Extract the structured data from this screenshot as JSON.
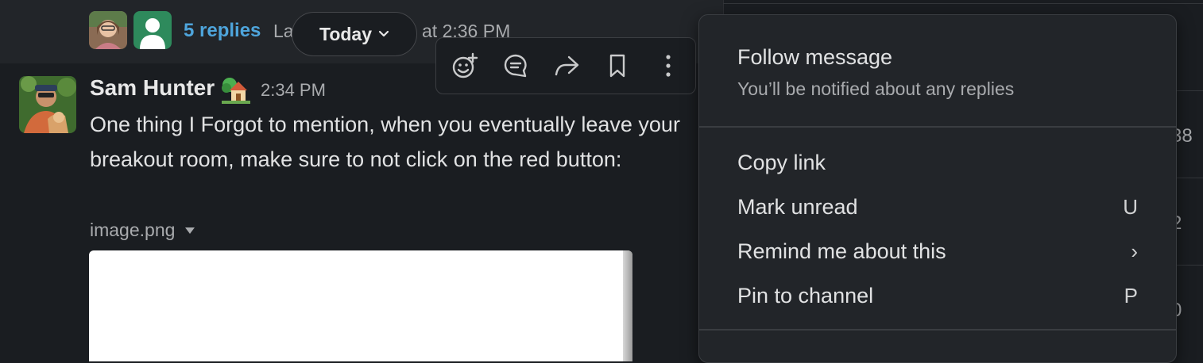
{
  "thread": {
    "replies_label": "5 replies",
    "last_reply_prefix": "La",
    "last_reply_time": "at 2:36 PM"
  },
  "date_divider": {
    "label": "Today"
  },
  "toolbar": {
    "icons": [
      "add-reaction-icon",
      "reply-in-thread-icon",
      "share-forward-icon",
      "bookmark-icon",
      "more-actions-icon"
    ]
  },
  "message": {
    "sender": "Sam Hunter",
    "status_emoji": "house-with-garden-icon",
    "time": "2:34 PM",
    "body": "One thing I Forgot to mention, when you eventually leave your breakout room, make sure to not click on the red button:",
    "attachment_name": "image.png"
  },
  "context_menu": {
    "follow_title": "Follow message",
    "follow_desc": "You’ll be notified about any replies",
    "items": [
      {
        "label": "Copy link",
        "shortcut": ""
      },
      {
        "label": "Mark unread",
        "shortcut": "U"
      },
      {
        "label": "Remind me about this",
        "shortcut": "›"
      },
      {
        "label": "Pin to channel",
        "shortcut": "P"
      }
    ]
  },
  "right_panel": {
    "numbers": [
      "38",
      "2",
      "0"
    ]
  },
  "colors": {
    "link": "#4ea5dc",
    "background": "#1a1d21",
    "menu_bg": "#222529"
  }
}
